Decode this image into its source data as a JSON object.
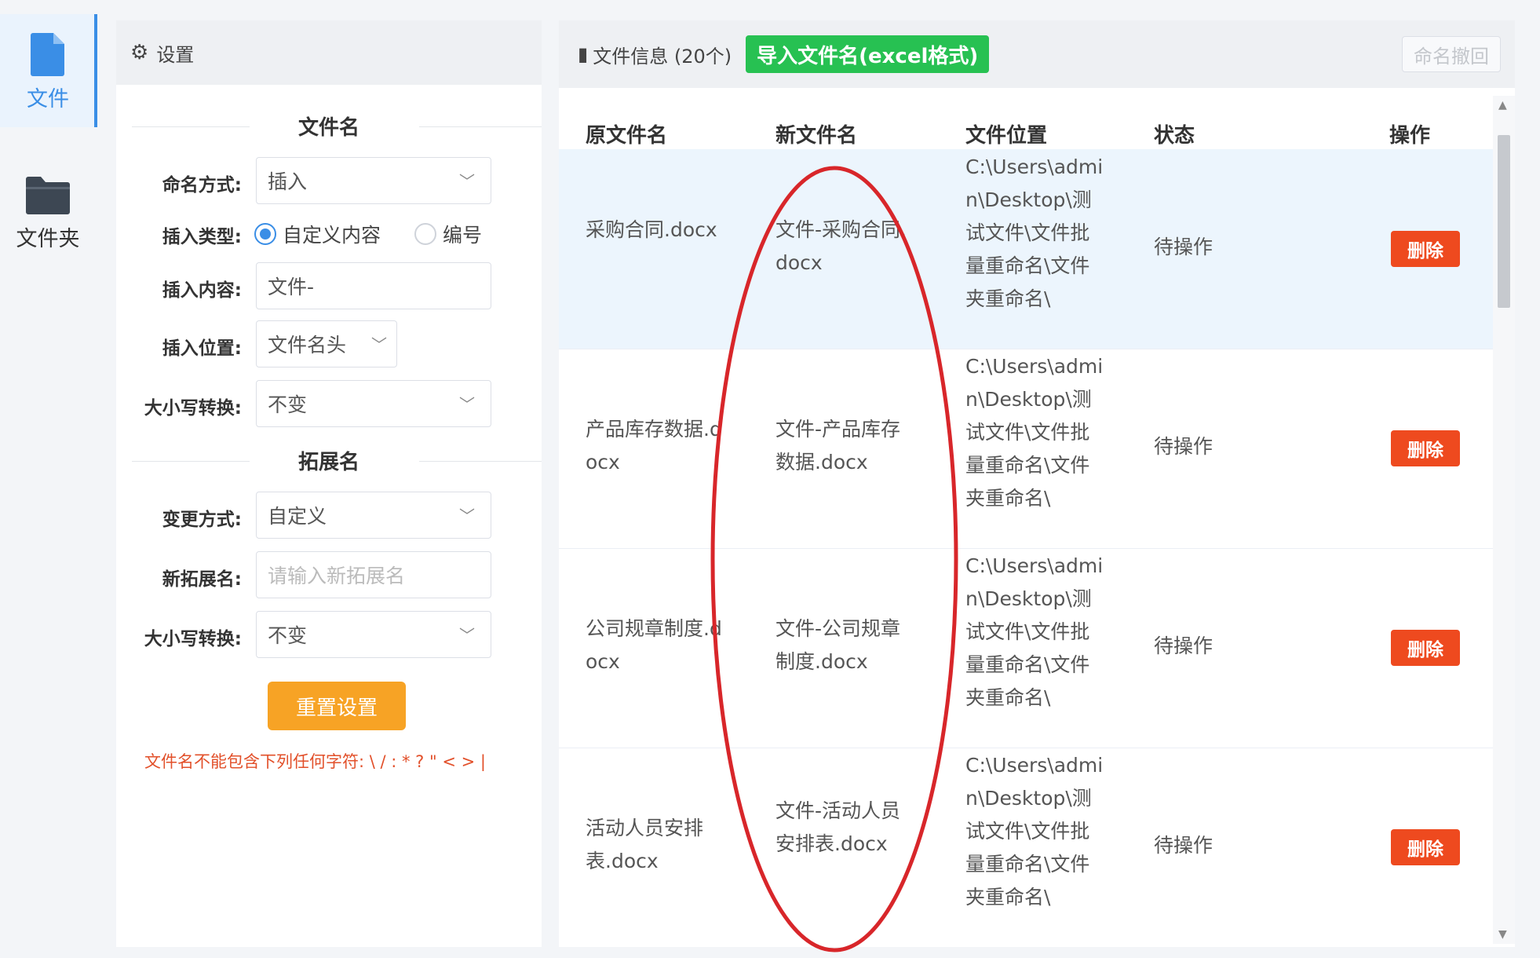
{
  "nav": {
    "file_label": "文件",
    "folder_label": "文件夹"
  },
  "settings": {
    "header": "设置",
    "filename_section": "文件名",
    "naming_label": "命名方式:",
    "naming_value": "插入",
    "insert_type_label": "插入类型:",
    "insert_type_options": [
      "自定义内容",
      "编号"
    ],
    "insert_content_label": "插入内容:",
    "insert_content_value": "文件-",
    "insert_position_label": "插入位置:",
    "insert_position_value": "文件名头",
    "case_label": "大小写转换:",
    "case_value": "不变",
    "ext_section": "拓展名",
    "change_mode_label": "变更方式:",
    "change_mode_value": "自定义",
    "new_ext_label": "新拓展名:",
    "new_ext_placeholder": "请输入新拓展名",
    "ext_case_label": "大小写转换:",
    "ext_case_value": "不变",
    "reset_button": "重置设置",
    "warning": "文件名不能包含下列任何字符: \\ / : * ? \" < > |"
  },
  "files": {
    "header": "文件信息 (20个)",
    "import_button": "导入文件名(excel格式)",
    "undo_button": "命名撤回",
    "columns": [
      "原文件名",
      "新文件名",
      "文件位置",
      "状态",
      "操作"
    ],
    "rows": [
      {
        "original": "采购合同.docx",
        "new": "文件-采购合同.docx",
        "path": "C:\\Users\\admin\\Desktop\\测试文件\\文件批量重命名\\文件夹重命名\\",
        "status": "待操作",
        "action": "删除"
      },
      {
        "original": "产品库存数据.docx",
        "new": "文件-产品库存数据.docx",
        "path": "C:\\Users\\admin\\Desktop\\测试文件\\文件批量重命名\\文件夹重命名\\",
        "status": "待操作",
        "action": "删除"
      },
      {
        "original": "公司规章制度.docx",
        "new": "文件-公司规章制度.docx",
        "path": "C:\\Users\\admin\\Desktop\\测试文件\\文件批量重命名\\文件夹重命名\\",
        "status": "待操作",
        "action": "删除"
      },
      {
        "original": "活动人员安排表.docx",
        "new": "文件-活动人员安排表.docx",
        "path": "C:\\Users\\admin\\Desktop\\测试文件\\文件批量重命名\\文件夹重命名\\",
        "status": "待操作",
        "action": "删除"
      }
    ]
  },
  "icons": {
    "file": "file-icon",
    "folder": "folder-icon",
    "gear": "gear-icon",
    "document": "document-icon",
    "chevron": "chevron-down-icon"
  },
  "colors": {
    "accent": "#3a8ee6",
    "import_green": "#27c152",
    "reset_orange": "#f7a325",
    "delete_red": "#ee4a1f",
    "annotation_red": "#d8262a",
    "warning_text": "#e2502a"
  }
}
